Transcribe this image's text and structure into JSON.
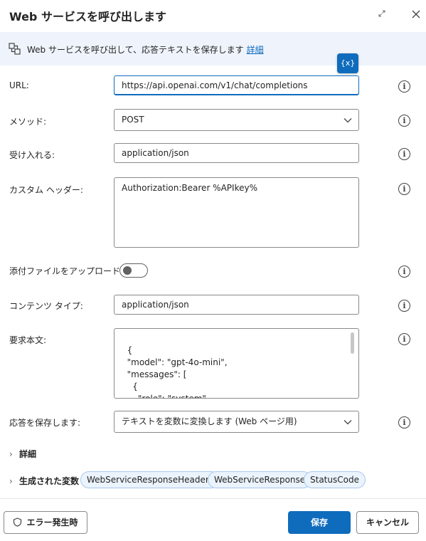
{
  "dialog": {
    "title": "Web サービスを呼び出します",
    "description": "Web サービスを呼び出して、応答テキストを保存します",
    "details_link": "詳細",
    "variable_button": "{x}"
  },
  "fields": {
    "url": {
      "label": "URL:",
      "value": "https://api.openai.com/v1/chat/completions"
    },
    "method": {
      "label": "メソッド:",
      "value": "POST"
    },
    "accept": {
      "label": "受け入れる:",
      "value": "application/json"
    },
    "custom_headers": {
      "label": "カスタム ヘッダー:",
      "value": "Authorization:Bearer %APIkey%"
    },
    "attach_file": {
      "label": "添付ファイルをアップロードする:",
      "enabled": false
    },
    "content_type": {
      "label": "コンテンツ タイプ:",
      "value": "application/json"
    },
    "request_body": {
      "label": "要求本文:",
      "value": "{\n  \"model\": \"gpt-4o-mini\",\n  \"messages\": [\n    {\n      \"role\": \"system\",\n      \"content\": \"%prompt%\""
    },
    "save_response": {
      "label": "応答を保存します:",
      "value": "テキストを変数に変換します (Web ページ用)"
    }
  },
  "sections": {
    "details": "詳細",
    "generated_vars": "生成された変数",
    "variables": [
      "WebServiceResponseHeaders",
      "WebServiceResponse",
      "StatusCode"
    ]
  },
  "footer": {
    "on_error": "エラー発生時",
    "save": "保存",
    "cancel": "キャンセル"
  },
  "colors": {
    "accent": "#0f6cbd",
    "banner_bg": "#eff4fc",
    "pill_bg": "#ebf3fc"
  }
}
